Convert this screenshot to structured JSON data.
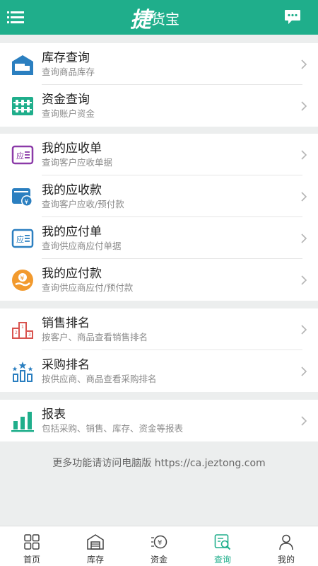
{
  "header": {
    "logo_main": "捷",
    "logo_sub": "货宝"
  },
  "groups": [
    {
      "items": [
        {
          "title": "库存查询",
          "subtitle": "查询商品库存",
          "icon": "warehouse-truck-icon"
        },
        {
          "title": "资金查询",
          "subtitle": "查询账户资金",
          "icon": "abacus-icon"
        }
      ]
    },
    {
      "items": [
        {
          "title": "我的应收单",
          "subtitle": "查询客户应收单据",
          "icon": "receivable-doc-icon"
        },
        {
          "title": "我的应收款",
          "subtitle": "查询客户应收/预付款",
          "icon": "yuan-wallet-icon"
        },
        {
          "title": "我的应付单",
          "subtitle": "查询供应商应付单据",
          "icon": "payable-doc-icon"
        },
        {
          "title": "我的应付款",
          "subtitle": "查询供应商应付/预付款",
          "icon": "yuan-coin-hand-icon"
        }
      ]
    },
    {
      "items": [
        {
          "title": "销售排名",
          "subtitle": "按客户、商品查看销售排名",
          "icon": "podium-icon"
        },
        {
          "title": "采购排名",
          "subtitle": "按供应商、商品查看采购排名",
          "icon": "star-bars-icon"
        }
      ]
    },
    {
      "items": [
        {
          "title": "报表",
          "subtitle": "包括采购、销售、库存、资金等报表",
          "icon": "bar-chart-icon"
        }
      ]
    }
  ],
  "footer_note": "更多功能请访问电脑版 https://ca.jeztong.com",
  "tabs": [
    {
      "label": "首页",
      "icon": "home-grid-icon",
      "active": false
    },
    {
      "label": "库存",
      "icon": "warehouse-icon",
      "active": false
    },
    {
      "label": "资金",
      "icon": "money-icon",
      "active": false
    },
    {
      "label": "查询",
      "icon": "search-doc-icon",
      "active": true
    },
    {
      "label": "我的",
      "icon": "person-icon",
      "active": false
    }
  ],
  "colors": {
    "brand": "#1fae8b",
    "purple": "#8b3aa8",
    "blue": "#2b7fc0",
    "orange": "#f29a2e",
    "red": "#d9534f"
  }
}
